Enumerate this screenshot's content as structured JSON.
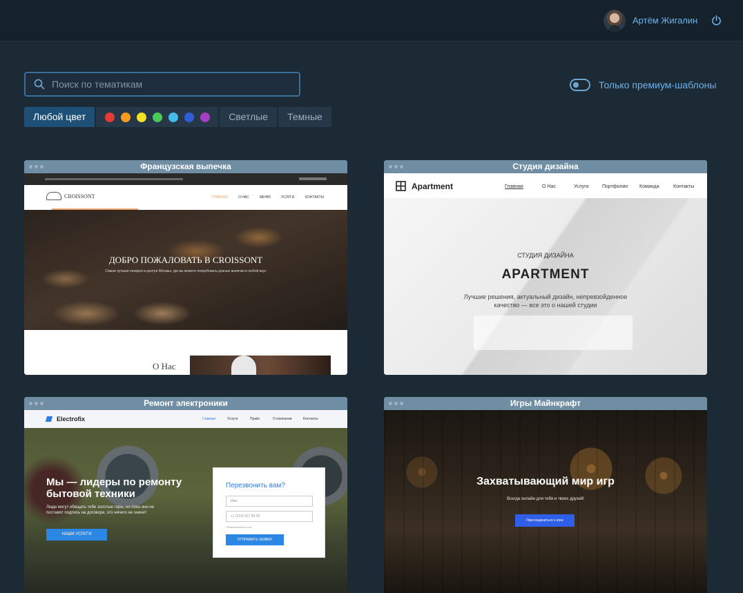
{
  "header": {
    "username": "Артём Жигалин"
  },
  "search": {
    "placeholder": "Поиск по тематикам"
  },
  "premium": {
    "label": "Только премиум-шаблоны"
  },
  "filters": {
    "any_color": "Любой цвет",
    "light": "Светлые",
    "dark": "Темные",
    "colors": [
      "#e53935",
      "#fb9b1e",
      "#f1e228",
      "#4bc95a",
      "#43bde8",
      "#2f5ed8",
      "#a43fc1"
    ]
  },
  "cards": [
    {
      "title": "Французская выпечка",
      "brand": "CROISSONT",
      "nav": [
        "ГЛАВНАЯ",
        "О НАС",
        "МЕНЮ",
        "УСЛУГИ",
        "КОНТАКТЫ"
      ],
      "hero": "ДОБРО ПОЖАЛОВАТЬ В CROISSONT",
      "sub": "Самая лучшая пекарня в центре Москвы, где вы можете попробовать разные выпечки в любой вкус",
      "about": "О Нас"
    },
    {
      "title": "Студия дизайна",
      "brand": "Apartment",
      "nav": [
        "Главная",
        "О Нас",
        "Услуги",
        "Портфолио",
        "Команда",
        "Контакты"
      ],
      "kicker": "СТУДИЯ ДИЗАЙНА",
      "hero": "APARTMENT",
      "sub1": "Лучшие решения, актуальный дизайн, непревзойденное",
      "sub2": "качество — все это о нашей студии"
    },
    {
      "title": "Ремонт электроники",
      "brand": "Electrofix",
      "nav": [
        "Главная",
        "Услуги",
        "Прайс",
        "О компании",
        "Контакты"
      ],
      "hero1": "Мы — лидеры по ремонту",
      "hero2": "бытовой техники",
      "sub1": "Люди могут обещать тебе золотые горы, но пока они не",
      "sub2": "поставят подпись на договоре, это ничего не значит",
      "cta": "НАШИ УСЛУГИ",
      "form_title": "Перезвонить вам?",
      "name_ph": "Имя",
      "phone_ph": "+1 (234) 567 89 99",
      "note": "Обязательные поля",
      "submit": "ОТПРАВИТЬ ЗАЯВКУ"
    },
    {
      "title": "Игры Майнкрафт",
      "hero": "Захватывающий мир игр",
      "sub": "Всегда онлайн для тебя и твоих друзей!",
      "cta": "Присоединиться к игре"
    }
  ]
}
